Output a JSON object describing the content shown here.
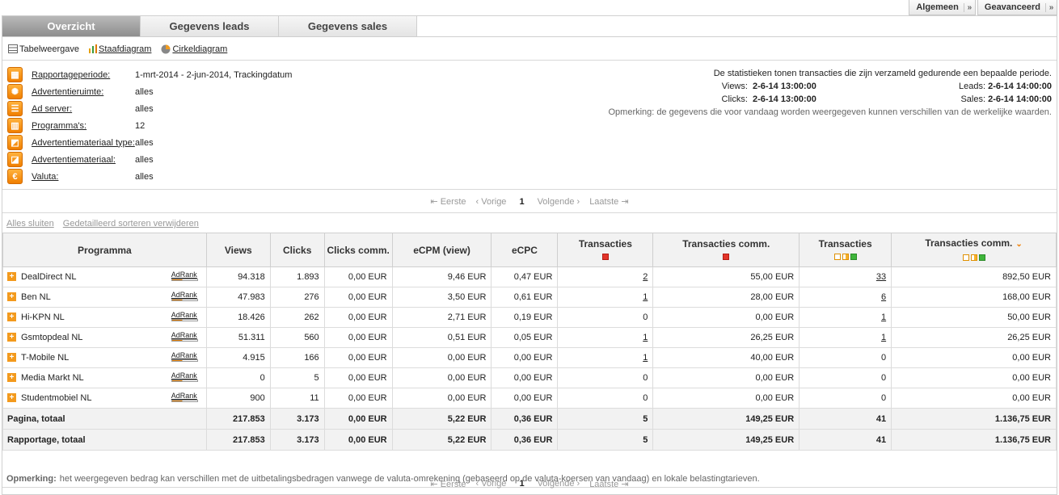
{
  "top_buttons": [
    {
      "label": "Algemeen",
      "arrow": "»"
    },
    {
      "label": "Geavanceerd",
      "arrow": "»"
    }
  ],
  "tabs": [
    {
      "label": "Overzicht",
      "active": true
    },
    {
      "label": "Gegevens leads",
      "active": false
    },
    {
      "label": "Gegevens sales",
      "active": false
    }
  ],
  "views": [
    {
      "label": "Tabelweergave",
      "icon": "table-icon",
      "link": false
    },
    {
      "label": "Staafdiagram",
      "icon": "bar-chart-icon",
      "link": true
    },
    {
      "label": "Cirkeldiagram",
      "icon": "pie-chart-icon",
      "link": true
    }
  ],
  "filters": [
    {
      "label": "Rapportageperiode:",
      "value": "1-mrt-2014 - 2-jun-2014, Trackingdatum",
      "icon": "calendar-icon",
      "glyph": "▦"
    },
    {
      "label": "Advertentieruimte:",
      "value": "alles",
      "icon": "globe-icon",
      "glyph": "✺"
    },
    {
      "label": "Ad server:",
      "value": "alles",
      "icon": "server-icon",
      "glyph": "☰"
    },
    {
      "label": "Programma's:",
      "value": "12",
      "icon": "grid-icon",
      "glyph": "▥"
    },
    {
      "label": "Advertentiemateriaal type:",
      "value": "alles",
      "icon": "media-type-icon",
      "glyph": "◩"
    },
    {
      "label": "Advertentiemateriaal:",
      "value": "alles",
      "icon": "media-icon",
      "glyph": "◪"
    },
    {
      "label": "Valuta:",
      "value": "alles",
      "icon": "euro-icon",
      "glyph": "€"
    }
  ],
  "stats": {
    "intro": "De statistieken tonen transacties die zijn verzameld gedurende een bepaalde periode.",
    "views_label": "Views:",
    "views_value": "2-6-14 13:00:00",
    "clicks_label": "Clicks:",
    "clicks_value": "2-6-14 13:00:00",
    "leads_label": "Leads:",
    "leads_value": "2-6-14 14:00:00",
    "sales_label": "Sales:",
    "sales_value": "2-6-14 14:00:00",
    "note": "Opmerking: de gegevens die voor vandaag worden weergegeven kunnen verschillen van de werkelijke waarden."
  },
  "pager": {
    "first": "Eerste",
    "prev": "Vorige",
    "current": "1",
    "next": "Volgende",
    "last": "Laatste"
  },
  "links": {
    "close_all": "Alles sluiten",
    "remove_sort": "Gedetailleerd sorteren verwijderen"
  },
  "table": {
    "adrank_label": "AdRank",
    "headers": [
      {
        "label": "Programma",
        "marks": []
      },
      {
        "label": "Views",
        "marks": []
      },
      {
        "label": "Clicks",
        "marks": []
      },
      {
        "label": "Clicks comm.",
        "marks": []
      },
      {
        "label": "eCPM (view)",
        "marks": []
      },
      {
        "label": "eCPC",
        "marks": []
      },
      {
        "label": "Transacties",
        "marks": [
          "r"
        ]
      },
      {
        "label": "Transacties comm.",
        "marks": [
          "r"
        ]
      },
      {
        "label": "Transacties",
        "marks": [
          "o",
          "oh",
          "g"
        ]
      },
      {
        "label": "Transacties comm.",
        "marks": [
          "o",
          "oh",
          "g"
        ],
        "sorted": true
      }
    ],
    "rows": [
      {
        "name": "DealDirect NL",
        "views": "94.318",
        "clicks": "1.893",
        "clicks_comm": "0,00 EUR",
        "ecpm": "9,46 EUR",
        "ecpc": "0,47 EUR",
        "tx_lead": "2",
        "tx_lead_comm": "55,00 EUR",
        "tx_sale": "33",
        "tx_sale_comm": "892,50 EUR",
        "lead_link": true,
        "sale_link": true
      },
      {
        "name": "Ben NL",
        "views": "47.983",
        "clicks": "276",
        "clicks_comm": "0,00 EUR",
        "ecpm": "3,50 EUR",
        "ecpc": "0,61 EUR",
        "tx_lead": "1",
        "tx_lead_comm": "28,00 EUR",
        "tx_sale": "6",
        "tx_sale_comm": "168,00 EUR",
        "lead_link": true,
        "sale_link": true
      },
      {
        "name": "Hi-KPN NL",
        "views": "18.426",
        "clicks": "262",
        "clicks_comm": "0,00 EUR",
        "ecpm": "2,71 EUR",
        "ecpc": "0,19 EUR",
        "tx_lead": "0",
        "tx_lead_comm": "0,00 EUR",
        "tx_sale": "1",
        "tx_sale_comm": "50,00 EUR",
        "lead_link": false,
        "sale_link": true
      },
      {
        "name": "Gsmtopdeal NL",
        "views": "51.311",
        "clicks": "560",
        "clicks_comm": "0,00 EUR",
        "ecpm": "0,51 EUR",
        "ecpc": "0,05 EUR",
        "tx_lead": "1",
        "tx_lead_comm": "26,25 EUR",
        "tx_sale": "1",
        "tx_sale_comm": "26,25 EUR",
        "lead_link": true,
        "sale_link": true
      },
      {
        "name": "T-Mobile NL",
        "views": "4.915",
        "clicks": "166",
        "clicks_comm": "0,00 EUR",
        "ecpm": "0,00 EUR",
        "ecpc": "0,00 EUR",
        "tx_lead": "1",
        "tx_lead_comm": "40,00 EUR",
        "tx_sale": "0",
        "tx_sale_comm": "0,00 EUR",
        "lead_link": true,
        "sale_link": false
      },
      {
        "name": "Media Markt NL",
        "views": "0",
        "clicks": "5",
        "clicks_comm": "0,00 EUR",
        "ecpm": "0,00 EUR",
        "ecpc": "0,00 EUR",
        "tx_lead": "0",
        "tx_lead_comm": "0,00 EUR",
        "tx_sale": "0",
        "tx_sale_comm": "0,00 EUR",
        "lead_link": false,
        "sale_link": false
      },
      {
        "name": "Studentmobiel NL",
        "views": "900",
        "clicks": "11",
        "clicks_comm": "0,00 EUR",
        "ecpm": "0,00 EUR",
        "ecpc": "0,00 EUR",
        "tx_lead": "0",
        "tx_lead_comm": "0,00 EUR",
        "tx_sale": "0",
        "tx_sale_comm": "0,00 EUR",
        "lead_link": false,
        "sale_link": false
      }
    ],
    "totals": [
      {
        "name": "Pagina, totaal",
        "views": "217.853",
        "clicks": "3.173",
        "clicks_comm": "0,00 EUR",
        "ecpm": "5,22 EUR",
        "ecpc": "0,36 EUR",
        "tx_lead": "5",
        "tx_lead_comm": "149,25 EUR",
        "tx_sale": "41",
        "tx_sale_comm": "1.136,75 EUR"
      },
      {
        "name": "Rapportage, totaal",
        "views": "217.853",
        "clicks": "3.173",
        "clicks_comm": "0,00 EUR",
        "ecpm": "5,22 EUR",
        "ecpc": "0,36 EUR",
        "tx_lead": "5",
        "tx_lead_comm": "149,25 EUR",
        "tx_sale": "41",
        "tx_sale_comm": "1.136,75 EUR"
      }
    ]
  },
  "remark": {
    "label": "Opmerking:",
    "text": "het weergegeven bedrag kan verschillen met de uitbetalingsbedragen vanwege de valuta-omrekening (gebaseerd op de valuta-koersen van vandaag) en lokale belastingtarieven."
  }
}
